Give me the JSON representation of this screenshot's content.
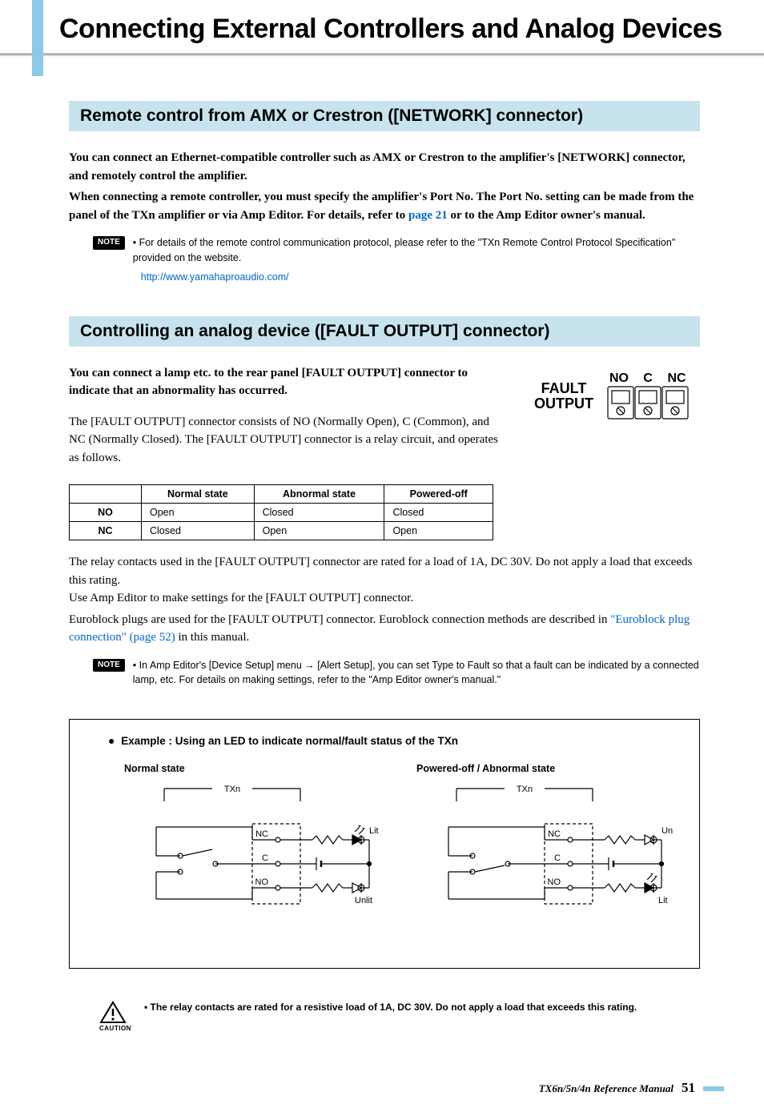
{
  "chapter_title": "Connecting External Controllers and Analog Devices",
  "section1": {
    "heading": "Remote control from AMX or Crestron ([NETWORK] connector)",
    "p1a": "You can connect an Ethernet-compatible controller such as AMX or Crestron to the amplifier's [NETWORK] connector, and remotely control the amplifier.",
    "p1b_pre": "When connecting a remote controller, you must specify the amplifier's Port No. The Port No. setting can be made from the panel of the TXn amplifier or via Amp Editor. For details, refer to ",
    "p1b_link": "page 21",
    "p1b_post": " or to the Amp Editor owner's manual.",
    "note_label": "NOTE",
    "note_bullet": "•",
    "note_text": "For details of the remote control communication protocol, please refer to the \"TXn Remote Control Protocol Specification\" provided on the website.",
    "note_url": "http://www.yamahaproaudio.com/"
  },
  "section2": {
    "heading": "Controlling an analog device ([FAULT OUTPUT] connector)",
    "p1": "You can connect a lamp etc. to the rear panel [FAULT OUTPUT] connector to indicate that an abnormality has occurred.",
    "p2": "The [FAULT OUTPUT] connector consists of NO (Normally Open), C (Common), and NC (Normally Closed). The [FAULT OUTPUT] connector is a relay circuit, and operates as follows.",
    "connector_label_1": "FAULT",
    "connector_label_2": "OUTPUT",
    "pin_labels": {
      "no": "NO",
      "c": "C",
      "nc": "NC"
    },
    "table": {
      "headers": [
        "",
        "Normal state",
        "Abnormal state",
        "Powered-off"
      ],
      "rows": [
        {
          "label": "NO",
          "cells": [
            "Open",
            "Closed",
            "Closed"
          ]
        },
        {
          "label": "NC",
          "cells": [
            "Closed",
            "Open",
            "Open"
          ]
        }
      ]
    },
    "after1": "The relay contacts used in the [FAULT OUTPUT] connector are rated for a load of 1A, DC 30V. Do not apply a load that exceeds this rating.",
    "after2": "Use Amp Editor to make settings for the [FAULT OUTPUT] connector.",
    "after3_pre": "Euroblock plugs are used for the [FAULT OUTPUT] connector. Euroblock connection methods are described in ",
    "after3_link": "\"Euroblock plug connection\" (page 52)",
    "after3_post": " in this manual.",
    "note_label": "NOTE",
    "note_bullet": "•",
    "note_text": "In Amp Editor's [Device Setup] menu → [Alert Setup], you can set Type to Fault so that a fault can be indicated by a connected lamp, etc. For details on making settings, refer to the \"Amp Editor owner's manual.\""
  },
  "diagram": {
    "title": "Example : Using an LED to indicate normal/fault status of the TXn",
    "bullet": "●",
    "left_label": "Normal state",
    "right_label": "Powered-off / Abnormal state",
    "txn": "TXn",
    "nc": "NC",
    "c": "C",
    "no": "NO",
    "lit": "Lit",
    "unlit": "Unlit"
  },
  "caution": {
    "label": "CAUTION",
    "bullet": "•",
    "text": "The relay contacts are rated for a resistive load of 1A, DC 30V. Do not apply a load that exceeds this rating."
  },
  "footer": {
    "manual": "TX6n/5n/4n  Reference Manual",
    "page": "51"
  }
}
